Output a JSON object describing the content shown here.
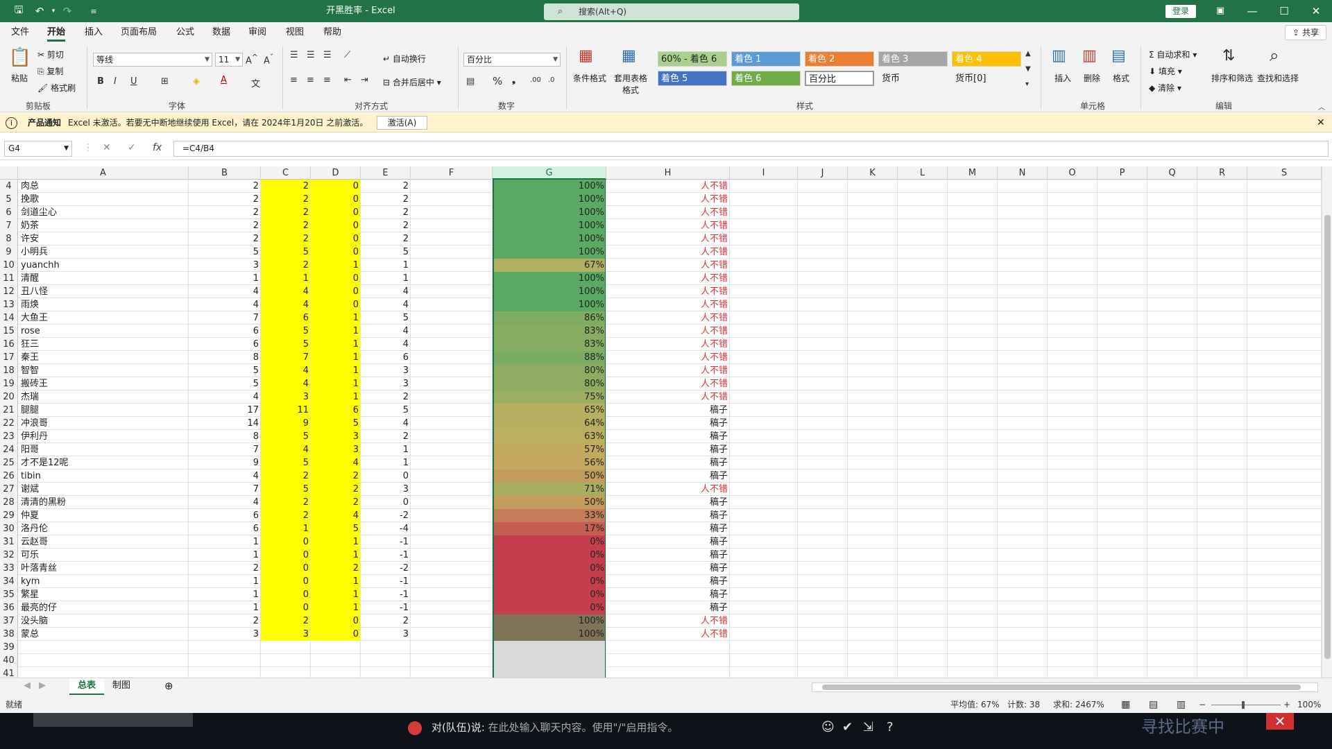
{
  "window": {
    "title": "开黑胜率 - Excel",
    "search_placeholder": "搜索(Alt+Q)",
    "login": "登录"
  },
  "menu": [
    "文件",
    "开始",
    "插入",
    "页面布局",
    "公式",
    "数据",
    "审阅",
    "视图",
    "帮助"
  ],
  "share": "共享",
  "ribbon": {
    "clipboard": {
      "paste": "粘贴",
      "cut": "剪切",
      "copy": "复制",
      "format_painter": "格式刷",
      "group": "剪贴板"
    },
    "font": {
      "name": "等线",
      "size": "11",
      "group": "字体"
    },
    "alignment": {
      "wrap": "自动换行",
      "merge": "合并后居中",
      "group": "对齐方式"
    },
    "number": {
      "format": "百分比",
      "group": "数字"
    },
    "styles": {
      "cond_format": "条件格式",
      "table_format": "套用表格格式",
      "items": [
        "60% - 着色 6",
        "着色 1",
        "着色 2",
        "着色 3",
        "着色 4",
        "着色 5",
        "着色 6",
        "百分比",
        "货币",
        "货币[0]"
      ],
      "group": "样式"
    },
    "cells": {
      "insert": "插入",
      "delete": "删除",
      "format": "格式",
      "group": "单元格"
    },
    "editing": {
      "autosum": "自动求和",
      "fill": "填充",
      "clear": "清除",
      "sort": "排序和筛选",
      "find": "查找和选择",
      "group": "编辑"
    }
  },
  "notice": {
    "label": "产品通知",
    "text": "Excel 未激活。若要无中断地继续使用 Excel，请在 2024年1月20日 之前激活。",
    "button": "激活(A)"
  },
  "formula": {
    "namebox": "G4",
    "value": "=C4/B4"
  },
  "columns": [
    "A",
    "B",
    "C",
    "D",
    "E",
    "F",
    "G",
    "H",
    "I",
    "J",
    "K",
    "L",
    "M",
    "N",
    "O",
    "P",
    "Q",
    "R",
    "S"
  ],
  "rows": [
    {
      "n": "4",
      "a": "肉总",
      "b": "2",
      "c": "2",
      "d": "0",
      "e": "2",
      "g": "100%",
      "pct": 1.0,
      "h": "人不错"
    },
    {
      "n": "5",
      "a": "挽歌",
      "b": "2",
      "c": "2",
      "d": "0",
      "e": "2",
      "g": "100%",
      "pct": 1.0,
      "h": "人不错"
    },
    {
      "n": "6",
      "a": "剑道尘心",
      "b": "2",
      "c": "2",
      "d": "0",
      "e": "2",
      "g": "100%",
      "pct": 1.0,
      "h": "人不错"
    },
    {
      "n": "7",
      "a": "奶茶",
      "b": "2",
      "c": "2",
      "d": "0",
      "e": "2",
      "g": "100%",
      "pct": 1.0,
      "h": "人不错"
    },
    {
      "n": "8",
      "a": "许安",
      "b": "2",
      "c": "2",
      "d": "0",
      "e": "2",
      "g": "100%",
      "pct": 1.0,
      "h": "人不错"
    },
    {
      "n": "9",
      "a": "小明兵",
      "b": "5",
      "c": "5",
      "d": "0",
      "e": "5",
      "g": "100%",
      "pct": 1.0,
      "h": "人不错"
    },
    {
      "n": "10",
      "a": "yuanchh",
      "b": "3",
      "c": "2",
      "d": "1",
      "e": "1",
      "g": "67%",
      "pct": 0.67,
      "h": "人不错"
    },
    {
      "n": "11",
      "a": "清醒",
      "b": "1",
      "c": "1",
      "d": "0",
      "e": "1",
      "g": "100%",
      "pct": 1.0,
      "h": "人不错"
    },
    {
      "n": "12",
      "a": "丑八怪",
      "b": "4",
      "c": "4",
      "d": "0",
      "e": "4",
      "g": "100%",
      "pct": 1.0,
      "h": "人不错"
    },
    {
      "n": "13",
      "a": "雨焕",
      "b": "4",
      "c": "4",
      "d": "0",
      "e": "4",
      "g": "100%",
      "pct": 1.0,
      "h": "人不错"
    },
    {
      "n": "14",
      "a": "大鱼王",
      "b": "7",
      "c": "6",
      "d": "1",
      "e": "5",
      "g": "86%",
      "pct": 0.86,
      "h": "人不错"
    },
    {
      "n": "15",
      "a": "rose",
      "b": "6",
      "c": "5",
      "d": "1",
      "e": "4",
      "g": "83%",
      "pct": 0.83,
      "h": "人不错"
    },
    {
      "n": "16",
      "a": "狂三",
      "b": "6",
      "c": "5",
      "d": "1",
      "e": "4",
      "g": "83%",
      "pct": 0.83,
      "h": "人不错"
    },
    {
      "n": "17",
      "a": "秦王",
      "b": "8",
      "c": "7",
      "d": "1",
      "e": "6",
      "g": "88%",
      "pct": 0.88,
      "h": "人不错"
    },
    {
      "n": "18",
      "a": "智智",
      "b": "5",
      "c": "4",
      "d": "1",
      "e": "3",
      "g": "80%",
      "pct": 0.8,
      "h": "人不错"
    },
    {
      "n": "19",
      "a": "搬砖王",
      "b": "5",
      "c": "4",
      "d": "1",
      "e": "3",
      "g": "80%",
      "pct": 0.8,
      "h": "人不错"
    },
    {
      "n": "20",
      "a": "杰瑞",
      "b": "4",
      "c": "3",
      "d": "1",
      "e": "2",
      "g": "75%",
      "pct": 0.75,
      "h": "人不错"
    },
    {
      "n": "21",
      "a": "腿腿",
      "b": "17",
      "c": "11",
      "d": "6",
      "e": "5",
      "g": "65%",
      "pct": 0.65,
      "h": "稿子"
    },
    {
      "n": "22",
      "a": "冲浪哥",
      "b": "14",
      "c": "9",
      "d": "5",
      "e": "4",
      "g": "64%",
      "pct": 0.64,
      "h": "稿子"
    },
    {
      "n": "23",
      "a": "伊利丹",
      "b": "8",
      "c": "5",
      "d": "3",
      "e": "2",
      "g": "63%",
      "pct": 0.63,
      "h": "稿子"
    },
    {
      "n": "24",
      "a": "阳哥",
      "b": "7",
      "c": "4",
      "d": "3",
      "e": "1",
      "g": "57%",
      "pct": 0.57,
      "h": "稿子"
    },
    {
      "n": "25",
      "a": "才不是12呢",
      "b": "9",
      "c": "5",
      "d": "4",
      "e": "1",
      "g": "56%",
      "pct": 0.56,
      "h": "稿子"
    },
    {
      "n": "26",
      "a": "tibin",
      "b": "4",
      "c": "2",
      "d": "2",
      "e": "0",
      "g": "50%",
      "pct": 0.5,
      "h": "稿子"
    },
    {
      "n": "27",
      "a": "谢斌",
      "b": "7",
      "c": "5",
      "d": "2",
      "e": "3",
      "g": "71%",
      "pct": 0.71,
      "h": "人不错"
    },
    {
      "n": "28",
      "a": "清清的黑粉",
      "b": "4",
      "c": "2",
      "d": "2",
      "e": "0",
      "g": "50%",
      "pct": 0.5,
      "h": "稿子"
    },
    {
      "n": "29",
      "a": "仲夏",
      "b": "6",
      "c": "2",
      "d": "4",
      "e": "-2",
      "g": "33%",
      "pct": 0.33,
      "h": "稿子"
    },
    {
      "n": "30",
      "a": "洛丹伦",
      "b": "6",
      "c": "1",
      "d": "5",
      "e": "-4",
      "g": "17%",
      "pct": 0.17,
      "h": "稿子"
    },
    {
      "n": "31",
      "a": "云赵哥",
      "b": "1",
      "c": "0",
      "d": "1",
      "e": "-1",
      "g": "0%",
      "pct": 0.0,
      "h": "稿子"
    },
    {
      "n": "32",
      "a": "可乐",
      "b": "1",
      "c": "0",
      "d": "1",
      "e": "-1",
      "g": "0%",
      "pct": 0.0,
      "h": "稿子"
    },
    {
      "n": "33",
      "a": "叶落青丝",
      "b": "2",
      "c": "0",
      "d": "2",
      "e": "-2",
      "g": "0%",
      "pct": 0.0,
      "h": "稿子"
    },
    {
      "n": "34",
      "a": "kym",
      "b": "1",
      "c": "0",
      "d": "1",
      "e": "-1",
      "g": "0%",
      "pct": 0.0,
      "h": "稿子"
    },
    {
      "n": "35",
      "a": "繁星",
      "b": "1",
      "c": "0",
      "d": "1",
      "e": "-1",
      "g": "0%",
      "pct": 0.0,
      "h": "稿子"
    },
    {
      "n": "36",
      "a": "最亮的仔",
      "b": "1",
      "c": "0",
      "d": "1",
      "e": "-1",
      "g": "0%",
      "pct": 0.0,
      "h": "稿子"
    },
    {
      "n": "37",
      "a": "没头脑",
      "b": "2",
      "c": "2",
      "d": "0",
      "e": "2",
      "g": "100%",
      "pct": 1.0,
      "h": "人不错",
      "dark": true
    },
    {
      "n": "38",
      "a": "蒙总",
      "b": "3",
      "c": "3",
      "d": "0",
      "e": "3",
      "g": "100%",
      "pct": 1.0,
      "h": "人不错",
      "dark": true
    },
    {
      "n": "39"
    },
    {
      "n": "40"
    },
    {
      "n": "41"
    }
  ],
  "sheets": [
    "总表",
    "制图"
  ],
  "status": {
    "ready": "就绪",
    "average": "平均值: 67%",
    "count": "计数: 38",
    "sum": "求和: 2467%",
    "zoom": "100%"
  },
  "overlay": {
    "speaker": "对(队伍)说:",
    "placeholder": "在此处输入聊天内容。使用\"/\"启用指令。",
    "brand": "寻找比赛中"
  },
  "colors": {
    "accent": "#217346",
    "highlight": "#ffff00",
    "good_text": "#e0303b"
  }
}
